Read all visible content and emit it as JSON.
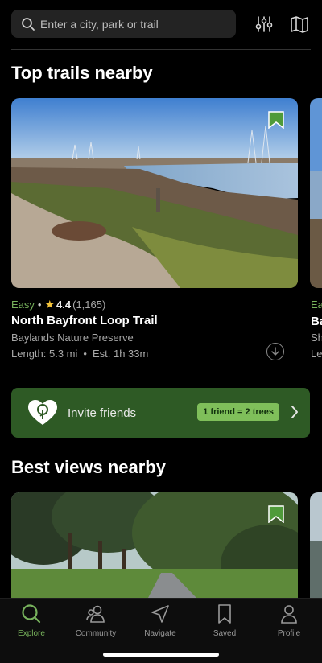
{
  "search": {
    "placeholder": "Enter a city, park or trail"
  },
  "sections": {
    "top_trails_title": "Top trails nearby",
    "best_views_title": "Best views nearby"
  },
  "trail_card": {
    "difficulty": "Easy",
    "rating": "4.4",
    "rating_count": "(1,165)",
    "name": "North Bayfront Loop Trail",
    "park": "Baylands Nature Preserve",
    "length": "Length: 5.3 mi",
    "duration": "Est. 1h 33m"
  },
  "peek_card": {
    "difficulty": "Ea",
    "name": "Ba",
    "park": "Sh",
    "length": "Le"
  },
  "invite": {
    "label": "Invite friends",
    "badge": "1 friend = 2 trees"
  },
  "tabs": [
    {
      "label": "Explore",
      "icon": "search-icon",
      "active": true
    },
    {
      "label": "Community",
      "icon": "people-icon",
      "active": false
    },
    {
      "label": "Navigate",
      "icon": "navigate-icon",
      "active": false
    },
    {
      "label": "Saved",
      "icon": "bookmark-icon",
      "active": false
    },
    {
      "label": "Profile",
      "icon": "person-icon",
      "active": false
    }
  ],
  "colors": {
    "accent": "#77b25c",
    "banner": "#2e5a25",
    "badge": "#7fbf5a",
    "star": "#f3c33b"
  }
}
